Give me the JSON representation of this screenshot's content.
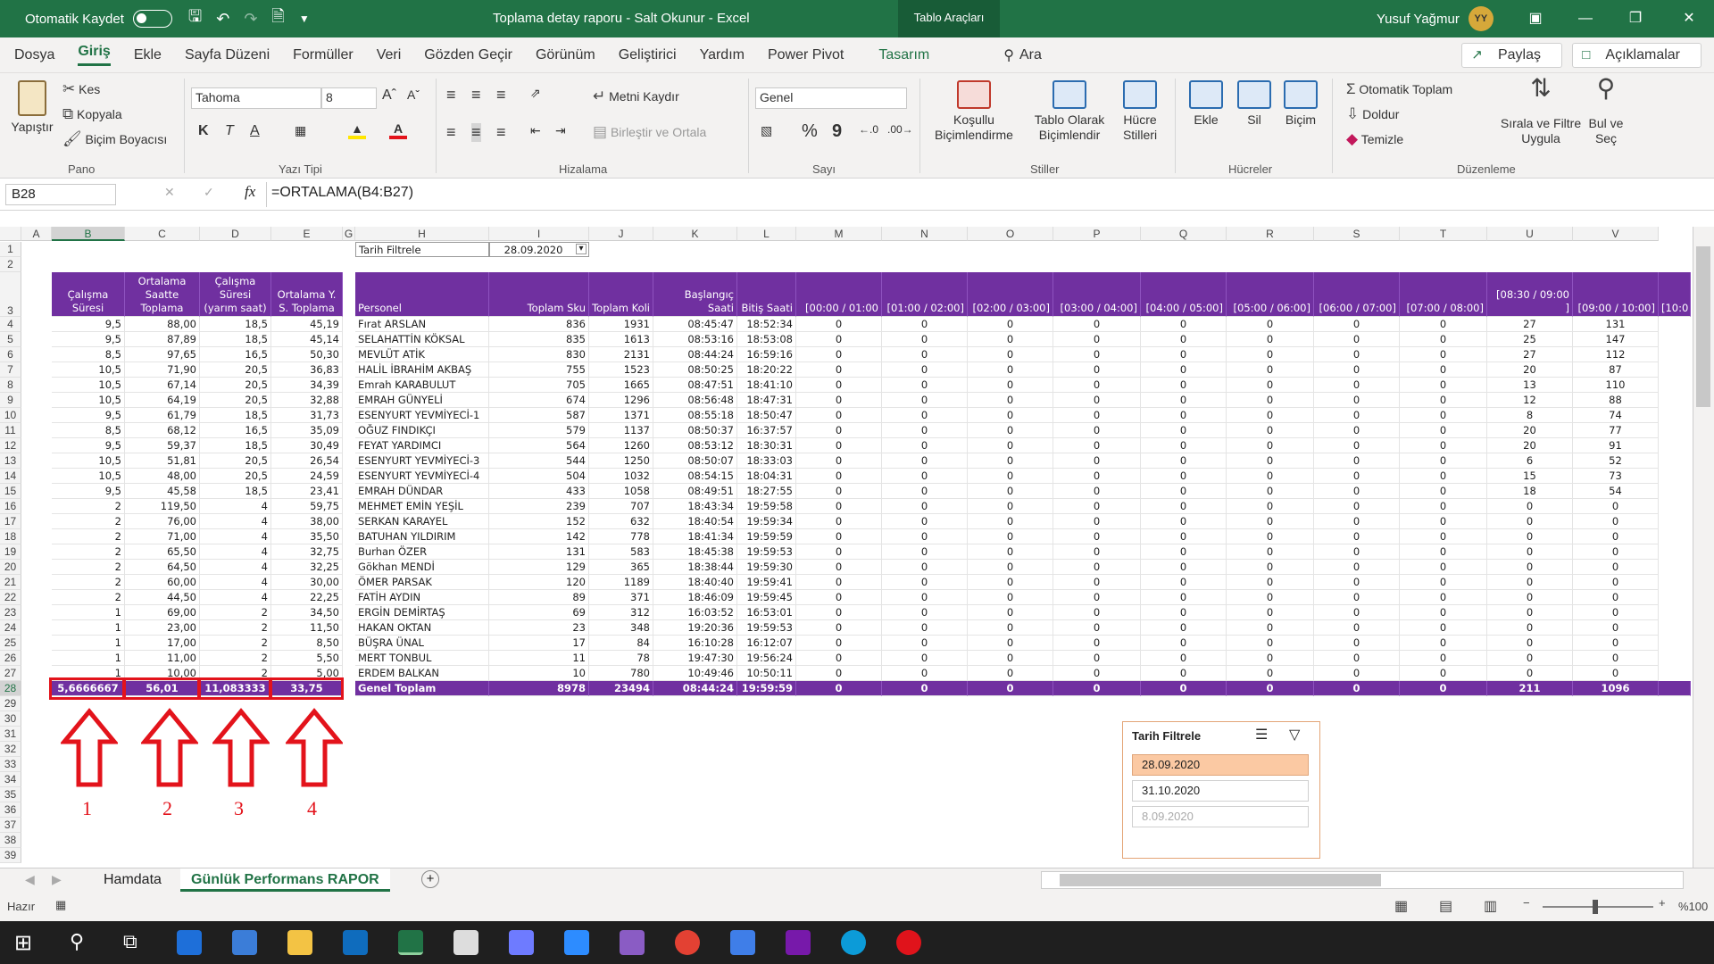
{
  "titlebar": {
    "autosave_label": "Otomatik Kaydet",
    "doc_title": "Toplama detay raporu - Salt Okunur - Excel",
    "tools_tab": "Tablo Araçları",
    "user_name": "Yusuf Yağmur",
    "user_initials": "YY"
  },
  "menu": {
    "items": [
      "Dosya",
      "Giriş",
      "Ekle",
      "Sayfa Düzeni",
      "Formüller",
      "Veri",
      "Gözden Geçir",
      "Görünüm",
      "Geliştirici",
      "Yardım",
      "Power Pivot"
    ],
    "design": "Tasarım",
    "search": "Ara",
    "share": "Paylaş",
    "comments": "Açıklamalar"
  },
  "ribbon": {
    "paste": "Yapıştır",
    "cut": "Kes",
    "copy": "Kopyala",
    "painter": "Biçim Boyacısı",
    "grp_pano": "Pano",
    "font": "Tahoma",
    "size": "8",
    "bold": "K",
    "italic": "T",
    "underline": "A",
    "grp_font": "Yazı Tipi",
    "wrap": "Metni Kaydır",
    "merge": "Birleştir ve Ortala",
    "grp_align": "Hizalama",
    "numfmt": "Genel",
    "percent": "%",
    "comma": "9",
    "grp_num": "Sayı",
    "cond1": "Koşullu",
    "cond2": "Biçimlendirme",
    "tbl1": "Tablo Olarak",
    "tbl2": "Biçimlendir",
    "cs1": "Hücre",
    "cs2": "Stilleri",
    "grp_styles": "Stiller",
    "insert": "Ekle",
    "delete": "Sil",
    "format": "Biçim",
    "grp_cells": "Hücreler",
    "autosum": "Otomatik Toplam",
    "fill": "Doldur",
    "clear": "Temizle",
    "sort1": "Sırala ve Filtre",
    "sort2": "Uygula",
    "find1": "Bul ve",
    "find2": "Seç",
    "grp_edit": "Düzenleme"
  },
  "formula_bar": {
    "name_box": "B28",
    "formula": "=ORTALAMA(B4:B27)"
  },
  "columns": [
    "A",
    "B",
    "C",
    "D",
    "E",
    "G",
    "H",
    "I",
    "J",
    "K",
    "L",
    "M",
    "N",
    "O",
    "P",
    "Q",
    "R",
    "S",
    "T",
    "U",
    "V"
  ],
  "filter": {
    "label": "Tarih Filtrele",
    "value": "28.09.2020"
  },
  "left_headers": {
    "b": "Çalışma Süresi",
    "c": "Ortalama Saatte Toplama",
    "d": "Çalışma Süresi (yarım saat)",
    "e": "Ortalama Y. S. Toplama"
  },
  "right_headers": [
    "Personel",
    "Toplam Sku",
    "Toplam Koli",
    "Başlangıç Saati",
    "Bitiş Saati",
    "[00:00 / 01:00",
    "[01:00 / 02:00]",
    "[02:00 / 03:00]",
    "[03:00 / 04:00]",
    "[04:00 / 05:00]",
    "[05:00 / 06:00]",
    "[06:00 / 07:00]",
    "[07:00 / 08:00]",
    "[08:30 / 09:00 ]",
    "[09:00 / 10:00]",
    "[10:0"
  ],
  "rows": [
    [
      "9,5",
      "88,00",
      "18,5",
      "45,19",
      "Fırat ARSLAN",
      "836",
      "1931",
      "08:45:47",
      "18:52:34",
      "27",
      "131"
    ],
    [
      "9,5",
      "87,89",
      "18,5",
      "45,14",
      "SELAHATTİN KÖKSAL",
      "835",
      "1613",
      "08:53:16",
      "18:53:08",
      "25",
      "147"
    ],
    [
      "8,5",
      "97,65",
      "16,5",
      "50,30",
      "MEVLÜT ATİK",
      "830",
      "2131",
      "08:44:24",
      "16:59:16",
      "27",
      "112"
    ],
    [
      "10,5",
      "71,90",
      "20,5",
      "36,83",
      "HALİL İBRAHİM AKBAŞ",
      "755",
      "1523",
      "08:50:25",
      "18:20:22",
      "20",
      "87"
    ],
    [
      "10,5",
      "67,14",
      "20,5",
      "34,39",
      "Emrah KARABULUT",
      "705",
      "1665",
      "08:47:51",
      "18:41:10",
      "13",
      "110"
    ],
    [
      "10,5",
      "64,19",
      "20,5",
      "32,88",
      "EMRAH GÜNYELİ",
      "674",
      "1296",
      "08:56:48",
      "18:47:31",
      "12",
      "88"
    ],
    [
      "9,5",
      "61,79",
      "18,5",
      "31,73",
      "ESENYURT YEVMİYECİ-1",
      "587",
      "1371",
      "08:55:18",
      "18:50:47",
      "8",
      "74"
    ],
    [
      "8,5",
      "68,12",
      "16,5",
      "35,09",
      "OĞUZ FINDIKÇI",
      "579",
      "1137",
      "08:50:37",
      "16:37:57",
      "20",
      "77"
    ],
    [
      "9,5",
      "59,37",
      "18,5",
      "30,49",
      "FEYAT YARDIMCI",
      "564",
      "1260",
      "08:53:12",
      "18:30:31",
      "20",
      "91"
    ],
    [
      "10,5",
      "51,81",
      "20,5",
      "26,54",
      "ESENYURT YEVMİYECİ-3",
      "544",
      "1250",
      "08:50:07",
      "18:33:03",
      "6",
      "52"
    ],
    [
      "10,5",
      "48,00",
      "20,5",
      "24,59",
      "ESENYURT YEVMİYECİ-4",
      "504",
      "1032",
      "08:54:15",
      "18:04:31",
      "15",
      "73"
    ],
    [
      "9,5",
      "45,58",
      "18,5",
      "23,41",
      "EMRAH DÜNDAR",
      "433",
      "1058",
      "08:49:51",
      "18:27:55",
      "18",
      "54"
    ],
    [
      "2",
      "119,50",
      "4",
      "59,75",
      "MEHMET EMİN YEŞİL",
      "239",
      "707",
      "18:43:34",
      "19:59:58",
      "0",
      "0"
    ],
    [
      "2",
      "76,00",
      "4",
      "38,00",
      "SERKAN KARAYEL",
      "152",
      "632",
      "18:40:54",
      "19:59:34",
      "0",
      "0"
    ],
    [
      "2",
      "71,00",
      "4",
      "35,50",
      "BATUHAN YILDIRIM",
      "142",
      "778",
      "18:41:34",
      "19:59:59",
      "0",
      "0"
    ],
    [
      "2",
      "65,50",
      "4",
      "32,75",
      "Burhan ÖZER",
      "131",
      "583",
      "18:45:38",
      "19:59:53",
      "0",
      "0"
    ],
    [
      "2",
      "64,50",
      "4",
      "32,25",
      "Gökhan MENDİ",
      "129",
      "365",
      "18:38:44",
      "19:59:30",
      "0",
      "0"
    ],
    [
      "2",
      "60,00",
      "4",
      "30,00",
      "ÖMER PARSAK",
      "120",
      "1189",
      "18:40:40",
      "19:59:41",
      "0",
      "0"
    ],
    [
      "2",
      "44,50",
      "4",
      "22,25",
      "FATİH AYDIN",
      "89",
      "371",
      "18:46:09",
      "19:59:45",
      "0",
      "0"
    ],
    [
      "1",
      "69,00",
      "2",
      "34,50",
      "ERGİN DEMİRTAŞ",
      "69",
      "312",
      "16:03:52",
      "16:53:01",
      "0",
      "0"
    ],
    [
      "1",
      "23,00",
      "2",
      "11,50",
      "HAKAN OKTAN",
      "23",
      "348",
      "19:20:36",
      "19:59:53",
      "0",
      "0"
    ],
    [
      "1",
      "17,00",
      "2",
      "8,50",
      "BÜŞRA ÜNAL",
      "17",
      "84",
      "16:10:28",
      "16:12:07",
      "0",
      "0"
    ],
    [
      "1",
      "11,00",
      "2",
      "5,50",
      "MERT TONBUL",
      "11",
      "78",
      "19:47:30",
      "19:56:24",
      "0",
      "0"
    ],
    [
      "1",
      "10,00",
      "2",
      "5,00",
      "ERDEM BALKAN",
      "10",
      "780",
      "10:49:46",
      "10:50:11",
      "0",
      "0"
    ]
  ],
  "total": {
    "b": "5,6666667",
    "c": "56,01",
    "d": "11,083333",
    "e": "33,75",
    "label": "Genel Toplam",
    "sku": "8978",
    "koli": "23494",
    "start": "08:44:24",
    "end": "19:59:59",
    "zero": "0",
    "u": "211",
    "v": "1096"
  },
  "arrows": [
    "1",
    "2",
    "3",
    "4"
  ],
  "slicer": {
    "title": "Tarih Filtrele",
    "items": [
      "28.09.2020",
      "31.10.2020",
      "8.09.2020"
    ]
  },
  "sheets": {
    "tab1": "Hamdata",
    "tab2": "Günlük Performans RAPOR"
  },
  "status": {
    "ready": "Hazır",
    "zoom": "%100"
  },
  "colors": {
    "excel_green": "#217346",
    "purple": "#7030a0",
    "red": "#e3131b"
  }
}
